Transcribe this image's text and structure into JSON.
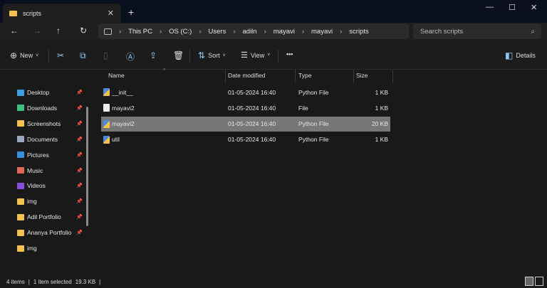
{
  "window": {
    "tab_title": "scripts",
    "new_tab": "+",
    "minimize": "—",
    "maximize": "☐",
    "close": "✕",
    "tab_close": "✕"
  },
  "nav": {
    "back": "←",
    "forward": "→",
    "up": "↑",
    "refresh": "↻"
  },
  "breadcrumb": [
    "This PC",
    "OS (C:)",
    "Users",
    "adiln",
    "mayavi",
    "mayavi",
    "scripts"
  ],
  "breadcrumb_sep": "›",
  "search": {
    "placeholder": "Search scripts",
    "icon": "⌕"
  },
  "toolbar": {
    "new": "New",
    "sort": "Sort",
    "view": "View",
    "more": "•••",
    "details": "Details",
    "caret": "˅"
  },
  "sidebar": {
    "items": [
      {
        "label": "Desktop",
        "icon": "desktop",
        "color": "#3aa0e0",
        "pinned": true
      },
      {
        "label": "Downloads",
        "icon": "download",
        "color": "#3fbf7f",
        "pinned": true
      },
      {
        "label": "Screenshots",
        "icon": "folder",
        "color": "#f2c14e",
        "pinned": true
      },
      {
        "label": "Documents",
        "icon": "document",
        "color": "#9aa6c0",
        "pinned": true
      },
      {
        "label": "Pictures",
        "icon": "pictures",
        "color": "#3a8ee0",
        "pinned": true
      },
      {
        "label": "Music",
        "icon": "music",
        "color": "#e06a5a",
        "pinned": true
      },
      {
        "label": "Videos",
        "icon": "videos",
        "color": "#8a4ee0",
        "pinned": true
      },
      {
        "label": "img",
        "icon": "folder",
        "color": "#f2c14e",
        "pinned": true
      },
      {
        "label": "Adil Portfolio",
        "icon": "folder",
        "color": "#f2c14e",
        "pinned": true
      },
      {
        "label": "Ananya Portfolio",
        "icon": "folder",
        "color": "#f2c14e",
        "pinned": true
      },
      {
        "label": "img",
        "icon": "folder",
        "color": "#f2c14e",
        "pinned": false
      }
    ]
  },
  "columns": {
    "name": "Name",
    "date": "Date modified",
    "type": "Type",
    "size": "Size"
  },
  "files": [
    {
      "name": "__init__",
      "date": "01-05-2024 16:40",
      "type": "Python File",
      "size": "1 KB",
      "selected": false
    },
    {
      "name": "mayavi2",
      "date": "01-05-2024 16:40",
      "type": "File",
      "size": "1 KB",
      "selected": false
    },
    {
      "name": "mayavi2",
      "date": "01-05-2024 16:40",
      "type": "Python File",
      "size": "20 KB",
      "selected": true
    },
    {
      "name": "util",
      "date": "01-05-2024 16:40",
      "type": "Python File",
      "size": "1 KB",
      "selected": false
    }
  ],
  "status": {
    "items": "4 items",
    "selected": "1 item selected",
    "size": "19.3 KB",
    "sep": "|"
  }
}
